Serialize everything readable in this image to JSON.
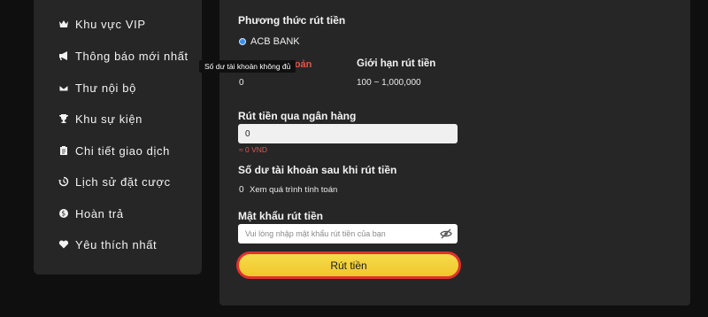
{
  "sidebar": {
    "items": [
      {
        "label": "Khu vực VIP",
        "icon": "crown-icon"
      },
      {
        "label": "Thông báo mới nhất",
        "icon": "megaphone-icon"
      },
      {
        "label": "Thư nội bộ",
        "icon": "envelope-icon"
      },
      {
        "label": "Khu sự kiện",
        "icon": "trophy-icon"
      },
      {
        "label": "Chi tiết giao dịch",
        "icon": "clipboard-icon"
      },
      {
        "label": "Lịch sử đặt cược",
        "icon": "history-icon"
      },
      {
        "label": "Hoàn trả",
        "icon": "dollar-coin-icon"
      },
      {
        "label": "Yêu thích nhất",
        "icon": "heart-icon"
      }
    ]
  },
  "tooltip": "Số dư tài khoản không đủ",
  "withdraw": {
    "method_label": "Phương thức rút tiền",
    "method_option": "ACB BANK",
    "balance_label_partial": "khoản",
    "balance_value": "0",
    "limit_label": "Giới hạn rút tiền",
    "limit_value": "100 ~ 1,000,000",
    "bank_label": "Rút tiền qua ngân hàng",
    "amount_value": "0",
    "converted": "≈ 0 VND",
    "after_label": "Số dư tài khoản sau khi rút tiền",
    "after_value": "0",
    "after_link": "Xem quá trình tính toán",
    "password_label": "Mật khẩu rút tiền",
    "password_placeholder": "Vui lòng nhập mật khẩu rút tiền của bạn",
    "submit": "Rút tiền"
  },
  "colors": {
    "accent_yellow": "#f0c62b",
    "button_border": "#e0312e",
    "warning_red": "#e0574f",
    "radio_blue": "#3d8ef0"
  }
}
